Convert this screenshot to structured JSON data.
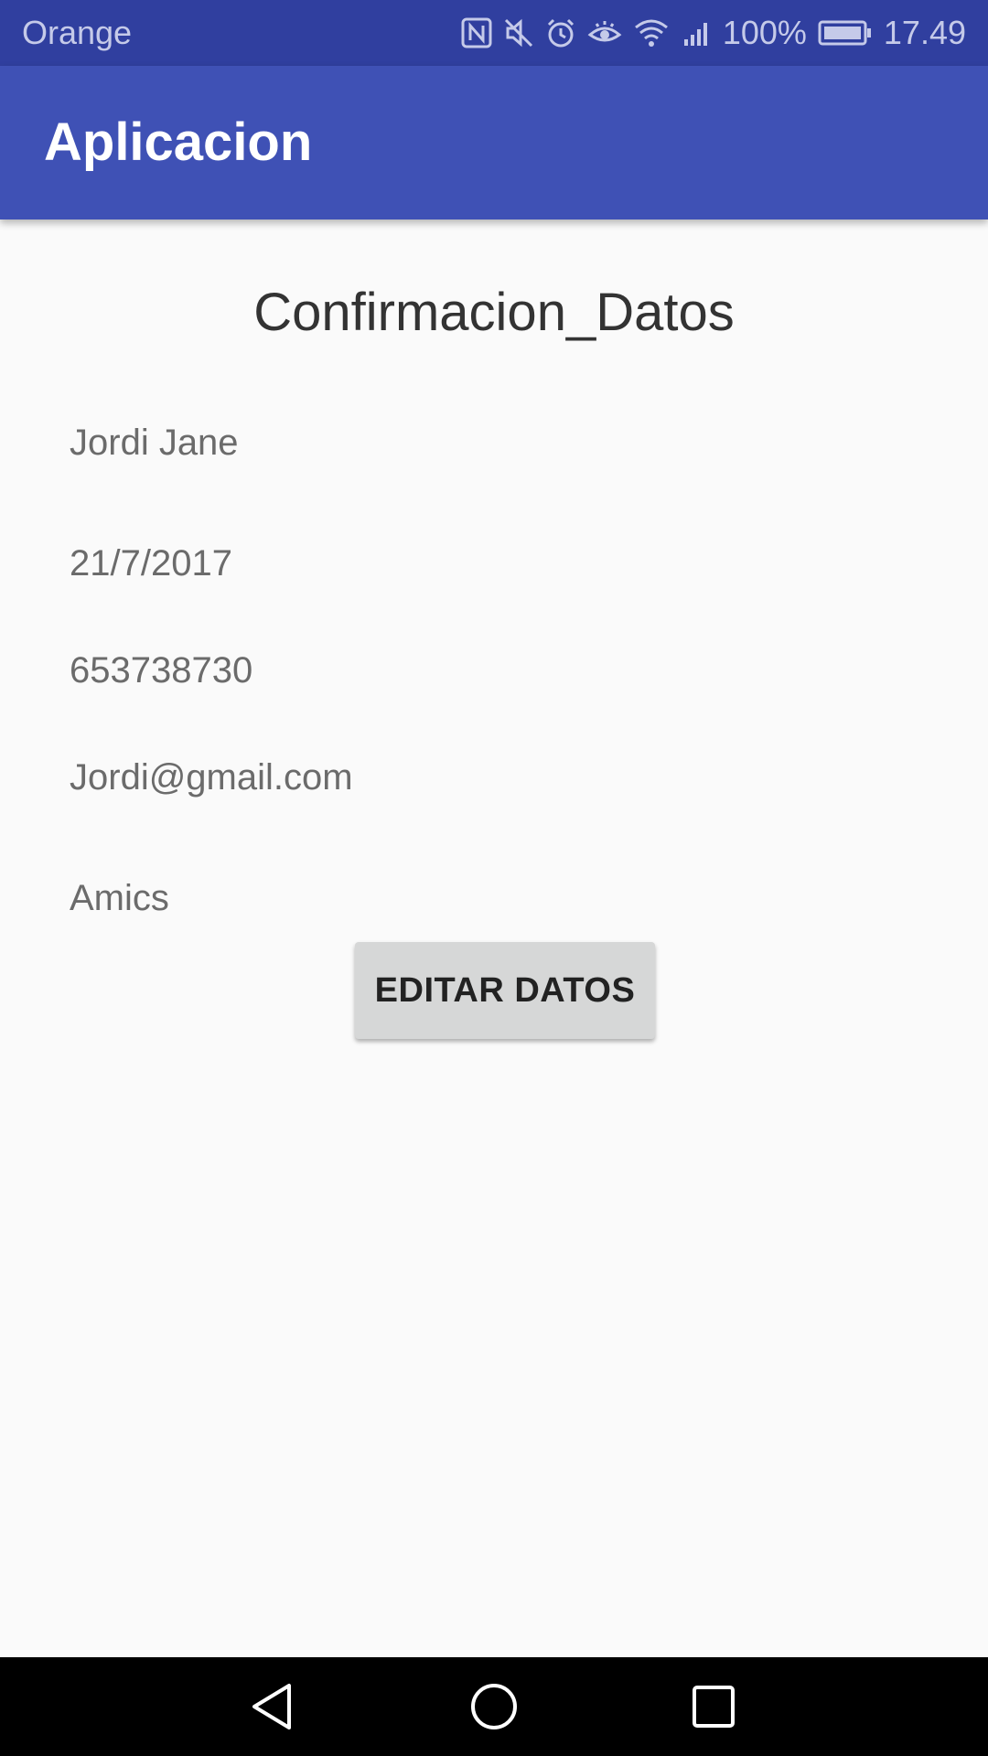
{
  "status_bar": {
    "carrier": "Orange",
    "battery_percent": "100%",
    "time": "17.49",
    "icons": [
      "nfc-icon",
      "mute-icon",
      "alarm-icon",
      "eye-comfort-icon",
      "wifi-icon",
      "signal-icon",
      "battery-icon"
    ]
  },
  "app_bar": {
    "title": "Aplicacion"
  },
  "screen": {
    "heading": "Confirmacion_Datos",
    "fields": {
      "name": "Jordi Jane",
      "date": "21/7/2017",
      "phone": "653738730",
      "email": "Jordi@gmail.com",
      "description": "Amics"
    },
    "edit_button_label": "EDITAR DATOS"
  },
  "nav_bar": {
    "icons": [
      "back-icon",
      "home-icon",
      "recents-icon"
    ]
  },
  "colors": {
    "status_bar": "#303f9f",
    "primary": "#3f51b5",
    "background": "#fafafa",
    "button": "#d6d7d7",
    "nav_bar": "#000000"
  }
}
